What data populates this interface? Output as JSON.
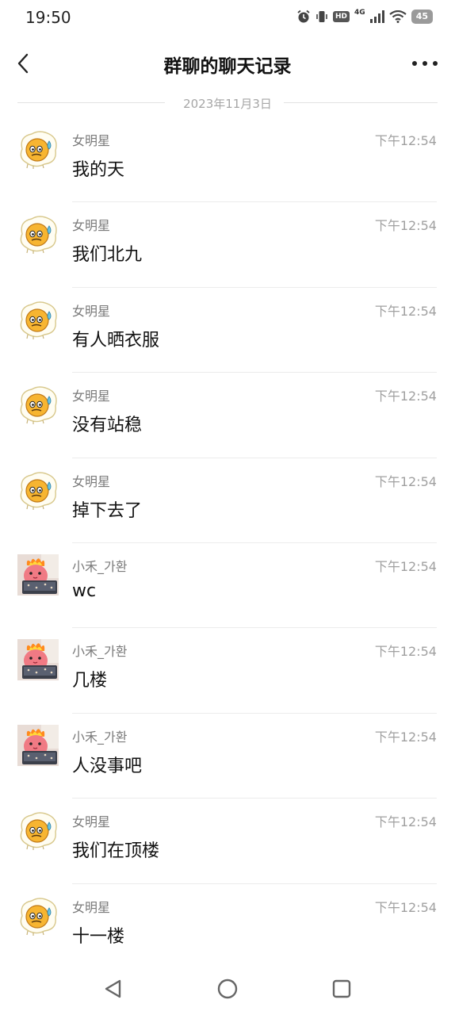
{
  "status_bar": {
    "time": "19:50",
    "network": "4G",
    "hd": "HD",
    "battery": "45"
  },
  "header": {
    "title": "群聊的聊天记录"
  },
  "date_separator": "2023年11月3日",
  "messages": [
    {
      "sender": "女明星",
      "time": "下午12:54",
      "text": "我的天",
      "avatar": "egg"
    },
    {
      "sender": "女明星",
      "time": "下午12:54",
      "text": "我们北九",
      "avatar": "egg"
    },
    {
      "sender": "女明星",
      "time": "下午12:54",
      "text": "有人晒衣服",
      "avatar": "egg"
    },
    {
      "sender": "女明星",
      "time": "下午12:54",
      "text": "没有站稳",
      "avatar": "egg"
    },
    {
      "sender": "女明星",
      "time": "下午12:54",
      "text": "掉下去了",
      "avatar": "egg"
    },
    {
      "sender": "小禾_가환",
      "time": "下午12:54",
      "text": "wc",
      "avatar": "pink"
    },
    {
      "sender": "小禾_가환",
      "time": "下午12:54",
      "text": "几楼",
      "avatar": "pink"
    },
    {
      "sender": "小禾_가환",
      "time": "下午12:54",
      "text": "人没事吧",
      "avatar": "pink"
    },
    {
      "sender": "女明星",
      "time": "下午12:54",
      "text": "我们在顶楼",
      "avatar": "egg"
    },
    {
      "sender": "女明星",
      "time": "下午12:54",
      "text": "十一楼",
      "avatar": "egg"
    }
  ]
}
